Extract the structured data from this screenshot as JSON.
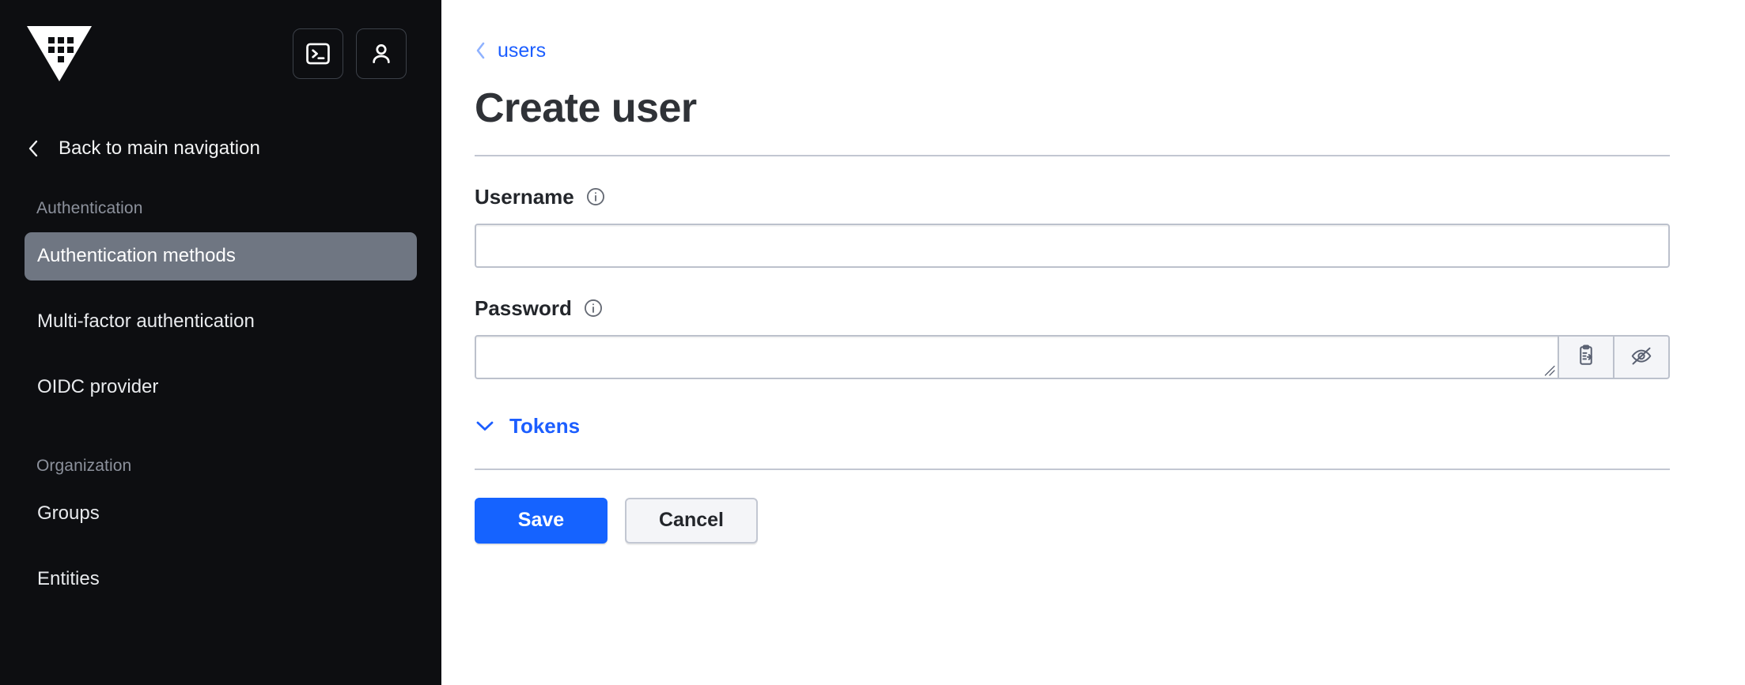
{
  "sidebar": {
    "logo_name": "vault-logo",
    "header_actions": [
      {
        "name": "console-toggle-button",
        "icon": "terminal-icon",
        "label": "Console"
      },
      {
        "name": "user-menu-button",
        "icon": "user-icon",
        "label": "User menu"
      }
    ],
    "back_label": "Back to main navigation",
    "groups": [
      {
        "title": "Authentication",
        "items": [
          {
            "label": "Authentication methods",
            "active": true
          },
          {
            "label": "Multi-factor authentication",
            "active": false
          },
          {
            "label": "OIDC provider",
            "active": false
          }
        ]
      },
      {
        "title": "Organization",
        "items": [
          {
            "label": "Groups",
            "active": false
          },
          {
            "label": "Entities",
            "active": false
          }
        ]
      }
    ]
  },
  "main": {
    "breadcrumb": {
      "chevron": "chevron-left-icon",
      "label": "users"
    },
    "title": "Create user",
    "fields": {
      "username": {
        "label": "Username",
        "value": "",
        "placeholder": "",
        "info_icon": "info-icon"
      },
      "password": {
        "label": "Password",
        "value": "",
        "placeholder": "",
        "info_icon": "info-icon",
        "copy_button_label": "Copy password",
        "reveal_button_label": "Show password"
      }
    },
    "tokens_toggle": {
      "label": "Tokens",
      "icon": "chevron-down-icon",
      "expanded": false
    },
    "actions": {
      "save_label": "Save",
      "cancel_label": "Cancel"
    }
  },
  "colors": {
    "sidebar_bg": "#0d0e11",
    "nav_active_bg": "#6f7682",
    "link_blue": "#1c5eff",
    "primary_blue": "#1563ff",
    "border_gray": "#bcc1cc",
    "title_dark": "#2f3237"
  }
}
